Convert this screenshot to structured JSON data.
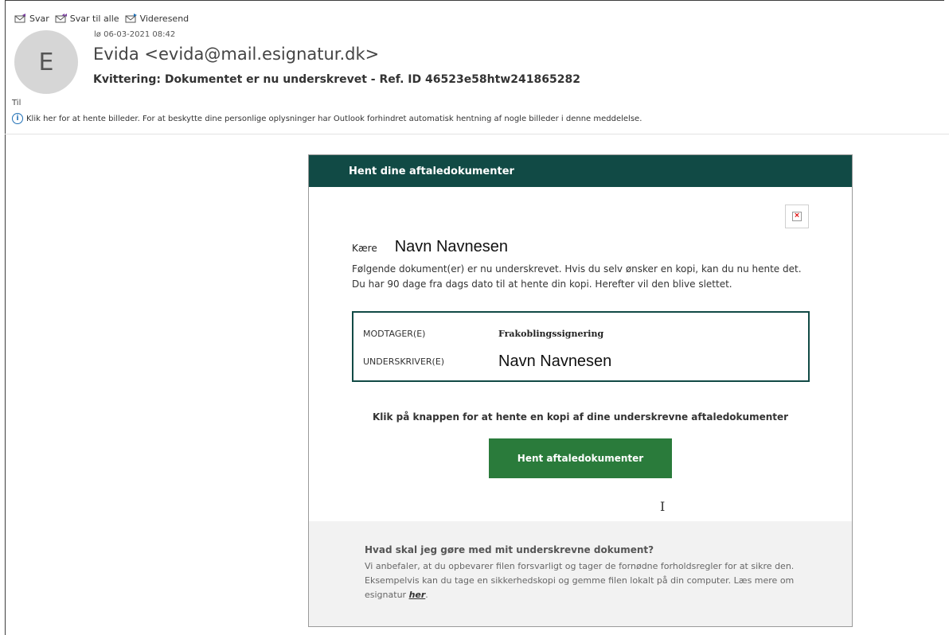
{
  "actions": {
    "reply": "Svar",
    "reply_all": "Svar til alle",
    "forward": "Videresend"
  },
  "email": {
    "avatar_letter": "E",
    "date": "lø 06-03-2021 08:42",
    "sender": "Evida <evida@mail.esignatur.dk>",
    "subject": "Kvittering: Dokumentet er nu underskrevet - Ref. ID 46523e58htw241865282",
    "to_label": "Til",
    "info_bar": "Klik her for at hente billeder. For at beskytte dine personlige oplysninger har Outlook forhindret automatisk hentning af nogle billeder i denne meddelelse."
  },
  "card": {
    "header": "Hent dine aftaledokumenter",
    "greeting_label": "Kære",
    "greeting_name": "Navn Navnesen",
    "body_line1": "Følgende dokument(er) er nu underskrevet. Hvis du selv ønsker en kopi, kan du nu hente det.",
    "body_line2": "Du har 90 dage fra dags dato til at hente din kopi. Herefter vil den blive slettet.",
    "recipient_label": "MODTAGER(E)",
    "recipient_value": "Frakoblingssignering",
    "signer_label": "UNDERSKRIVER(E)",
    "signer_value": "Navn Navnesen",
    "cta_text": "Klik på knappen for at hente en kopi af dine underskrevne aftaledokumenter",
    "cta_button": "Hent aftaledokumenter",
    "footer_title": "Hvad skal jeg gøre med mit underskrevne dokument?",
    "footer_text": "Vi anbefaler, at du opbevarer filen forsvarligt og tager de fornødne forholdsregler for at sikre den. Eksempelvis kan du tage en sikkerhedskopi og gemme filen lokalt på din computer. Læs mere om esignatur ",
    "footer_link": "her",
    "footer_end": "."
  },
  "colors": {
    "header_bg": "#114a45",
    "button_bg": "#2a7b3b",
    "footer_bg": "#f2f2f2"
  }
}
